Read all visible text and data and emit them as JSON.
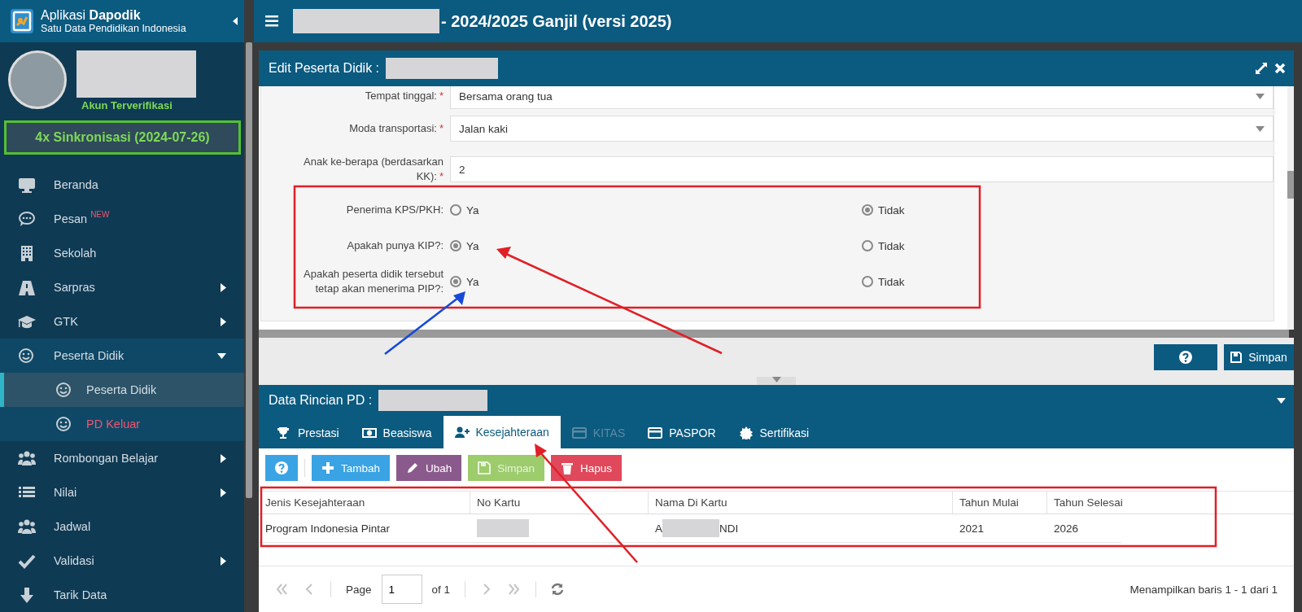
{
  "app": {
    "title": "Aplikasi **Dapodik**",
    "subtitle": "Satu Data Pendidikan Indonesia"
  },
  "profile": {
    "name_redacted": true,
    "status": "Akun Terverifikasi",
    "sync": "4x Sinkronisasi (2024-07-26)"
  },
  "sidebar": {
    "items": [
      {
        "label": "Beranda",
        "has_submenu": false,
        "expanded": false
      },
      {
        "label": "Pesan",
        "badge": "NEW",
        "has_submenu": false,
        "expanded": false
      },
      {
        "label": "Sekolah",
        "has_submenu": false,
        "expanded": false
      },
      {
        "label": "Sarpras",
        "has_submenu": true,
        "expanded": false
      },
      {
        "label": "GTK",
        "has_submenu": true,
        "expanded": false
      },
      {
        "label": "Peserta Didik",
        "has_submenu": true,
        "expanded": true,
        "children": [
          {
            "label": "Peserta Didik",
            "selected": true,
            "color": "#d3dde3"
          },
          {
            "label": "PD Keluar",
            "selected": false,
            "color": "#f2566f"
          }
        ]
      },
      {
        "label": "Rombongan Belajar",
        "has_submenu": true,
        "expanded": false
      },
      {
        "label": "Nilai",
        "has_submenu": true,
        "expanded": false
      },
      {
        "label": "Jadwal",
        "has_submenu": false,
        "expanded": false
      },
      {
        "label": "Validasi",
        "has_submenu": true,
        "expanded": false
      },
      {
        "label": "Tarik Data",
        "has_submenu": false,
        "expanded": false
      }
    ]
  },
  "header": {
    "school_redacted": true,
    "title": "- 2024/2025 Ganjil (versi 2025)"
  },
  "edit_panel": {
    "title": "Edit Peserta Didik :",
    "name_redacted": true,
    "fields": [
      {
        "kind": "select",
        "label": "Tempat tinggal:",
        "required_mark": "*",
        "value": "Bersama orang tua"
      },
      {
        "kind": "select",
        "label": "Moda transportasi:",
        "required_mark": "*",
        "value": "Jalan kaki"
      },
      {
        "kind": "text",
        "label": "Anak ke-berapa (berdasarkan KK):",
        "required_mark": "*",
        "value": "2"
      },
      {
        "kind": "radio",
        "label": "Penerima KPS/PKH:",
        "options": [
          {
            "label": "Ya",
            "selected": false
          },
          {
            "label": "Tidak",
            "selected": true
          }
        ]
      },
      {
        "kind": "radio",
        "label": "Apakah punya KIP?:",
        "options": [
          {
            "label": "Ya",
            "selected": true
          },
          {
            "label": "Tidak",
            "selected": false
          }
        ]
      },
      {
        "kind": "radio",
        "label": "Apakah peserta didik tersebut tetap akan menerima PIP?:",
        "options": [
          {
            "label": "Ya",
            "selected": true
          },
          {
            "label": "Tidak",
            "selected": false
          }
        ]
      }
    ],
    "buttons": [
      {
        "kind": "help"
      },
      {
        "kind": "save",
        "label": "Simpan"
      }
    ]
  },
  "detail_panel": {
    "title": "Data Rincian PD :",
    "name_redacted": true,
    "tabs": [
      {
        "label": "Prestasi",
        "selected": false,
        "disabled": false
      },
      {
        "label": "Beasiswa",
        "selected": false,
        "disabled": false
      },
      {
        "label": "Kesejahteraan",
        "selected": true,
        "disabled": false
      },
      {
        "label": "KITAS",
        "selected": false,
        "disabled": true
      },
      {
        "label": "PASPOR",
        "selected": false,
        "disabled": false
      },
      {
        "label": "Sertifikasi",
        "selected": false,
        "disabled": false
      }
    ],
    "toolbar": [
      {
        "kind": "help",
        "color": "#3aa3e3",
        "disabled": false
      },
      {
        "kind": "add",
        "label": "Tambah",
        "color": "#3aa3e3",
        "disabled": false
      },
      {
        "kind": "edit",
        "label": "Ubah",
        "color": "#8b5a8c",
        "disabled": false
      },
      {
        "kind": "save",
        "label": "Simpan",
        "color": "#9ccc6b",
        "disabled": true
      },
      {
        "kind": "delete",
        "label": "Hapus",
        "color": "#e0495b",
        "disabled": false
      }
    ],
    "table": {
      "columns": [
        "Jenis Kesejahteraan",
        "No Kartu",
        "Nama Di Kartu",
        "Tahun Mulai",
        "Tahun Selesai"
      ],
      "rows": [
        {
          "cells": [
            {
              "kind": "text",
              "text": "Program Indonesia Pintar"
            },
            {
              "kind": "redacted"
            },
            {
              "kind": "partly_redacted",
              "before": "A",
              "after": "NDI"
            },
            {
              "kind": "text",
              "text": "2021"
            },
            {
              "kind": "text",
              "text": "2026"
            }
          ]
        }
      ]
    },
    "pagination": {
      "nav_before": [
        {
          "kind": "first",
          "disabled": true
        },
        {
          "kind": "prev",
          "disabled": true
        }
      ],
      "page_label": "Page",
      "page": "1",
      "of": "of 1",
      "nav_after": [
        {
          "kind": "next",
          "disabled": true
        },
        {
          "kind": "last",
          "disabled": true
        }
      ],
      "summary": "Menampilkan baris 1 - 1 dari 1"
    }
  }
}
